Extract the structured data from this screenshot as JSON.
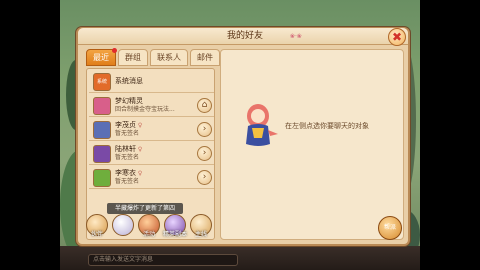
{
  "window": {
    "title": "我的好友",
    "title_deco": "❀·❀",
    "close_label": "✖"
  },
  "tabs": [
    {
      "label": "最近",
      "active": true,
      "badge": true
    },
    {
      "label": "群组",
      "active": false,
      "badge": false
    },
    {
      "label": "联系人",
      "active": false,
      "badge": false
    },
    {
      "label": "邮件",
      "active": false,
      "badge": false
    }
  ],
  "friend_list": [
    {
      "name": "系统消息",
      "sub": "",
      "avatar_color": "#e26b2a",
      "avatar_text": "系统",
      "action_icon": ""
    },
    {
      "name": "梦幻精灵",
      "sub": "回合制摸金夺宝玩法...",
      "avatar_color": "#d85f8a",
      "avatar_text": "",
      "action_icon": "home-icon"
    },
    {
      "name": "李茂贞",
      "sub": "暂无签名",
      "avatar_color": "#5a6fb5",
      "avatar_text": "",
      "action_icon": "chevron-right-icon"
    },
    {
      "name": "陆林轩",
      "sub": "暂无签名",
      "avatar_color": "#7a4aa6",
      "avatar_text": "",
      "action_icon": "chevron-right-icon"
    },
    {
      "name": "李寒衣",
      "sub": "暂无签名",
      "avatar_color": "#6fae3d",
      "avatar_text": "",
      "action_icon": "chevron-right-icon"
    }
  ],
  "right_panel": {
    "hint": "在左侧点选你要聊天的对象"
  },
  "notice": "半藏爆炸了更新了第四",
  "bottom_icons": [
    {
      "label": "伙伴"
    },
    {
      "label": ""
    },
    {
      "label": "活动"
    },
    {
      "label": "精英副本"
    },
    {
      "label": "主线"
    }
  ],
  "side_button": {
    "label": "帮派"
  },
  "chat": {
    "placeholder": "点击输入发送文字消息"
  },
  "colors": {
    "panel_bg": "#e9cfa7",
    "tab_active": "#e07e1a",
    "accent_red": "#d2332a"
  }
}
